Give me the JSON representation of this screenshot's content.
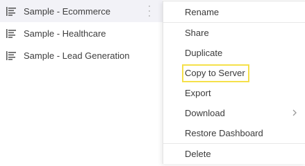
{
  "dashboards": [
    {
      "label": "Sample - Ecommerce",
      "active": true
    },
    {
      "label": "Sample - Healthcare",
      "active": false
    },
    {
      "label": "Sample - Lead Generation",
      "active": false
    }
  ],
  "menu": {
    "items": [
      {
        "label": "Rename"
      },
      {
        "label": "Share"
      },
      {
        "label": "Duplicate"
      },
      {
        "label": "Copy to Server",
        "highlighted": true
      },
      {
        "label": "Export"
      },
      {
        "label": "Download",
        "submenu": true
      },
      {
        "label": "Restore Dashboard"
      },
      {
        "label": "Delete"
      }
    ]
  },
  "colors": {
    "active_row_bg": "#f2f2f7",
    "highlight_border": "#f5e04a",
    "text": "#3a3a3a",
    "divider": "#e8e8e8"
  },
  "icons": {
    "dashboard_item": "dashboard-list-icon",
    "row_menu": "kebab-menu-icon",
    "submenu": "chevron-right-icon"
  }
}
